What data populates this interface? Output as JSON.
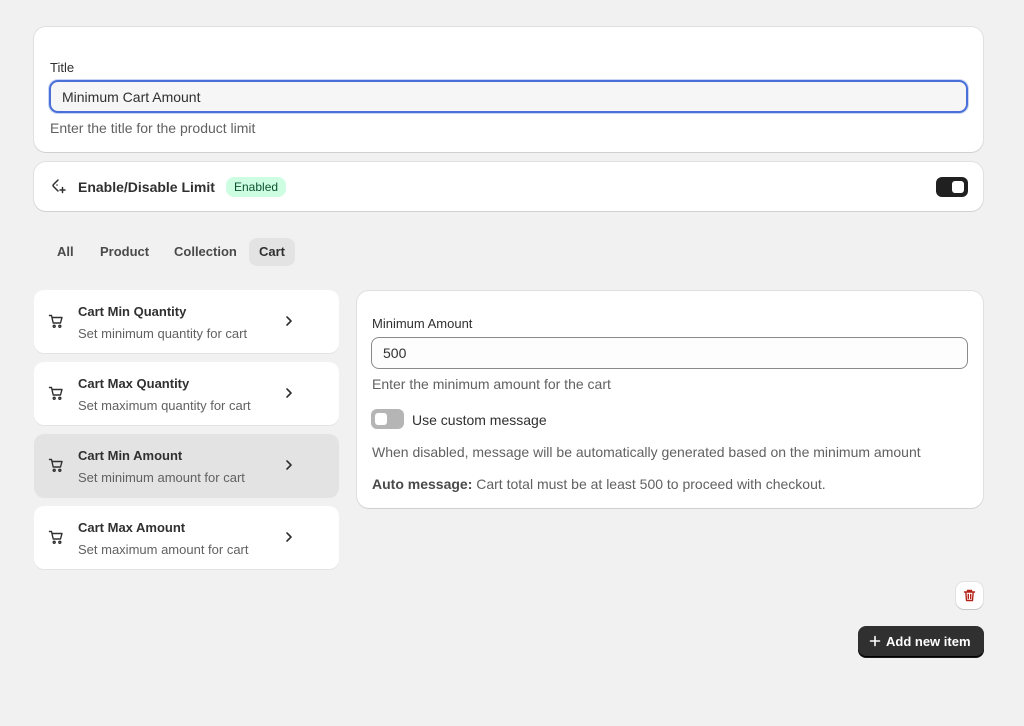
{
  "title_section": {
    "label": "Title",
    "value": "Minimum Cart Amount",
    "help": "Enter the title for the product limit"
  },
  "enable_section": {
    "label": "Enable/Disable Limit",
    "badge": "Enabled",
    "toggle_on": true,
    "icon": "tag-refresh-icon"
  },
  "tabs": [
    {
      "label": "All"
    },
    {
      "label": "Product"
    },
    {
      "label": "Collection"
    },
    {
      "label": "Cart",
      "active": true
    }
  ],
  "items": [
    {
      "title": "Cart Min Quantity",
      "subtitle": "Set minimum quantity for cart",
      "icon": "cart-icon"
    },
    {
      "title": "Cart Max Quantity",
      "subtitle": "Set maximum quantity for cart",
      "icon": "cart-icon"
    },
    {
      "title": "Cart Min Amount",
      "subtitle": "Set minimum amount for cart",
      "icon": "cart-icon",
      "selected": true
    },
    {
      "title": "Cart Max Amount",
      "subtitle": "Set maximum amount for cart",
      "icon": "cart-icon"
    }
  ],
  "detail": {
    "amount_label": "Minimum Amount",
    "amount_value": "500",
    "amount_help": "Enter the minimum amount for the cart",
    "custom_message_label": "Use custom message",
    "custom_message_on": false,
    "disabled_note": "When disabled, message will be automatically generated based on the minimum amount",
    "auto_message_prefix": "Auto message:",
    "auto_message_text": " Cart total must be at least 500 to proceed with checkout."
  },
  "actions": {
    "delete_icon": "trash-icon",
    "add_label": "Add new item"
  },
  "colors": {
    "accent_focus": "#4a6fd8",
    "badge_bg": "#cdfee1",
    "badge_text": "#0c5132",
    "primary_button": "#303030",
    "delete_icon": "#b42318"
  }
}
